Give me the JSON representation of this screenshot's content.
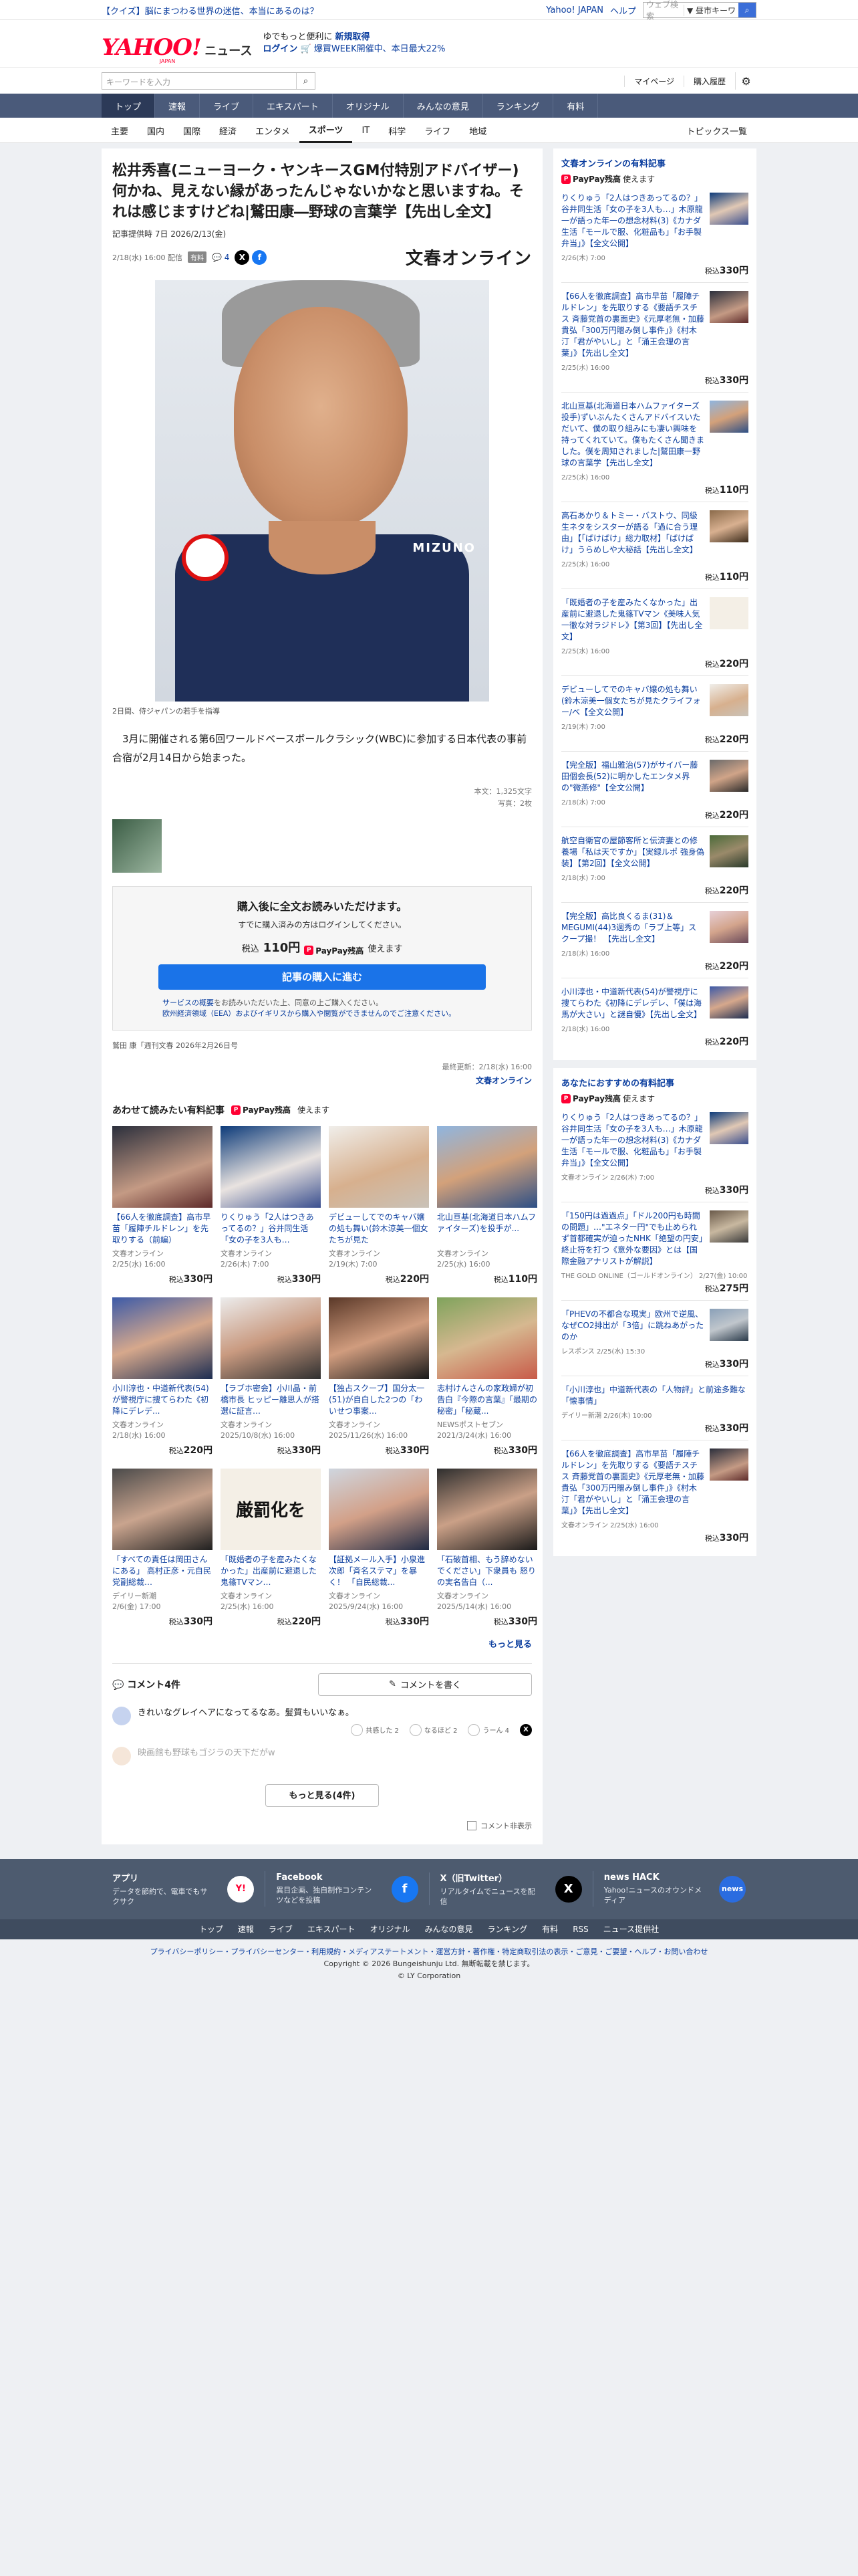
{
  "notice": {
    "text": "【クイズ】脳にまつわる世界の迷信、本当にあるのは？",
    "links": [
      "Yahoo! JAPAN",
      "ヘルプ"
    ],
    "search_placeholder": "ウェブ検索",
    "search_scope": "▼ 昼市キーワ"
  },
  "masthead": {
    "logo_main": "YAHOO!",
    "logo_sub": "JAPAN",
    "logo_news": "ニュース",
    "promo_line1_a": "ゆでもっと便利に",
    "promo_line1_b": "新規取得",
    "promo_line2_a": "ログイン",
    "promo_line2_b": "🛒 爆買WEEK開催中、本日最大22%"
  },
  "searchbar": {
    "placeholder": "キーワードを入力",
    "links": [
      "マイページ",
      "購入履歴"
    ]
  },
  "catnav": [
    "トップ",
    "速報",
    "ライブ",
    "エキスパート",
    "オリジナル",
    "みんなの意見",
    "ランキング",
    "有料"
  ],
  "catnav_active": 0,
  "subnav": [
    "主要",
    "国内",
    "国際",
    "経済",
    "エンタメ",
    "スポーツ",
    "IT",
    "科学",
    "ライフ",
    "地域"
  ],
  "subnav_right": "トピックス一覧",
  "article": {
    "title": "松井秀喜(ニューヨーク・ヤンキースGM付特別アドバイザー)何かね、見えない縁があったんじゃないかなと思いますね。それは感じますけどね|鷲田康―野球の言葉学【先出し全文】",
    "byline": "記事提供時 7日 2026/2/13(金)",
    "date": "2/18(水) 16:00 配信",
    "badge": "有料",
    "comment_count": "4",
    "brand": "文春オンライン",
    "photo_caption": "2日間、侍ジャパンの若手を指導",
    "photo_text": "MIZUNO",
    "lead": "3月に開催される第6回ワールドベースボールクラシック(WBC)に参加する日本代表の事前合宿が2月14日から始まった。",
    "char_count": "本文：1,325文字",
    "photo_count": "写真：2枚"
  },
  "paybox": {
    "title": "購入後に全文お読みいただけます。",
    "sub": "すでに購入済みの方はログインしてください。",
    "price_prefix": "税込",
    "price": "110円",
    "paypay": "PayPay残高",
    "paypay_suffix": "使えます",
    "buy": "記事の購入に進む",
    "note1": "サービスの概要",
    "note1b": "をお読みいただいた上、同意の上ご購入ください。",
    "note2": "欧州経済領域（EEA）およびイギリスから購入や閲覧ができませんのでご注意ください。"
  },
  "source": "鷲田 康「週刊文春 2026年2月26日号",
  "updated": "最終更新：2/18(水) 16:00",
  "updated_by": "文春オンライン",
  "related": {
    "heading": "あわせて読みたい有料記事",
    "paypay": "PayPay残高",
    "paypay_suffix": "使えます",
    "items": [
      {
        "title": "【66人を徹底調査】高市早苗「履陣チルドレン」を先取りする（前編）",
        "src": "文春オンライン",
        "date": "2/25(水) 16:00",
        "price": "330円"
      },
      {
        "title": "りくりゅう「2人はつきあってるの？」谷井同生活「女の子を3人も…",
        "src": "文春オンライン",
        "date": "2/26(木) 7:00",
        "price": "330円"
      },
      {
        "title": "デビューしてでのキャバ嬢の処も舞い(鈴木涼美一個女たちが見た",
        "src": "文春オンライン",
        "date": "2/19(木) 7:00",
        "price": "220円"
      },
      {
        "title": "北山亘基(北海道日本ハムファイターズ)を投手が...",
        "src": "文春オンライン",
        "date": "2/25(水) 16:00",
        "price": "110円"
      },
      {
        "title": "小川淳也・中道新代表(54)が警視庁に捜てらわた《初降にデレデ...",
        "src": "文春オンライン",
        "date": "2/18(水) 16:00",
        "price": "220円"
      },
      {
        "title": "【ラブホ密会】小川晶・前橋市長 ヒッピー離思人が搭選に証言…",
        "src": "文春オンライン",
        "date": "2025/10/8(水) 16:00",
        "price": "330円"
      },
      {
        "title": "【独占スクープ】国分太一(51)が自白した2つの「わいせつ事案…",
        "src": "文春オンライン",
        "date": "2025/11/26(水) 16:00",
        "price": "330円"
      },
      {
        "title": "志村けんさんの家政婦が初告白『今際の言葉』「最期の秘密」「秘蔵...",
        "src": "NEWSポストセブン",
        "date": "2021/3/24(水) 16:00",
        "price": "330円"
      },
      {
        "title": "「すべての責任は岡田さんにある」 高村正彦・元自民党副総裁…",
        "src": "デイリー新潮",
        "date": "2/6(金) 17:00",
        "price": "330円"
      },
      {
        "title": "「既婚者の子を産みたくなかった」出産前に避退した鬼篠TVマン…",
        "src": "文春オンライン",
        "date": "2/25(水) 16:00",
        "price": "220円"
      },
      {
        "title": "【証拠メール入手】小泉進次郎「斉名ステマ」を暴く！ 「自民総裁...",
        "src": "文春オンライン",
        "date": "2025/9/24(水) 16:00",
        "price": "330円"
      },
      {
        "title": "「石破首相、もう辞めないでください」下衆員も 怒りの実名告白（...",
        "src": "文春オンライン",
        "date": "2025/5/14(水) 16:00",
        "price": "330円"
      }
    ],
    "more": "もっと見る"
  },
  "comments": {
    "heading": "コメント4件",
    "write": "コメントを書く",
    "items": [
      {
        "text": "きれいなグレイヘアになってるなあ。髪質もいいなぁ。",
        "r1": "共感した 2",
        "r2": "なるほど 2",
        "r3": "うーん 4"
      },
      {
        "text": "映画館も野球もゴジラの天下だがw"
      }
    ],
    "more": "もっと見る(4件)",
    "hide": "コメント非表示"
  },
  "sidebar": {
    "box1": {
      "heading": "文春オンラインの有料記事",
      "paypay": "PayPay残高",
      "paypay_suffix": "使えます",
      "items": [
        {
          "title": "りくりゅう「2人はつきあってるの？」谷井同生活「女の子を3人も…」木原龍一が語った年一の想念材料(3)《カナダ生活「モールで服、化粧品も」「お手製弁当」》【全文公開】",
          "date": "2/26(木) 7:00",
          "price": "330円"
        },
        {
          "title": "【66人を徹底調査】高市早苗「履陣チルドレン」を先取りする《要語チスチス 斉藤党首の裏面史》《元厚老無・加藤貴弘「300万円贈み倒し事件」》《村木汀「君がやいし」と「涌王会理の言葉」》【先出し全文】",
          "date": "2/25(水) 16:00",
          "price": "330円"
        },
        {
          "title": "北山亘基(北海道日本ハムファイターズ 投手)ずいぶんたくさんアドバイスいただいて、僕の取り組みにも凄い興味を持ってくれていて。僕もたくさん聞きました。僕を周知されました|鷲田康一野球の言葉学【先出し全文】",
          "date": "2/25(水) 16:00",
          "price": "110円"
        },
        {
          "title": "高石あかり＆トミー・バストウ、同級生ネタをシスターが語る「過に合う理由」【「ばけばけ」総力取材】「ばけばけ」うらめしや大秘話【先出し全文】",
          "date": "2/25(水) 16:00",
          "price": "110円"
        },
        {
          "title": "「既婚者の子を産みたくなかった」出産前に避退した鬼篠TVマン《美味人気一徹な対ラジドレ》【第3回】【先出し全文】",
          "date": "2/25(水) 16:00",
          "price": "220円"
        },
        {
          "title": "デビューしてでのキャバ嬢の処も舞い(鈴木涼美一個女たちが見たクライフォー/ベ【全文公開】",
          "date": "2/19(木) 7:00",
          "price": "220円"
        },
        {
          "title": "【完全版】福山雅治(57)がサイバー藤田個会長(52)に明かしたエンタメ界の\"微燕修\"【全文公開】",
          "date": "2/18(水) 7:00",
          "price": "220円"
        },
        {
          "title": "航空自衛官の屋節客所と伝済妻との修養場「私は天ですか」【実録ルポ 強身偽装】【第2回】【全文公開】",
          "date": "2/18(水) 7:00",
          "price": "220円"
        },
        {
          "title": "【完全版】高比良くるま(31)＆MEGUMI(44)3週秀の「ラブ上等」スクープ撮！ 【先出し全文】",
          "date": "2/18(水) 16:00",
          "price": "220円"
        },
        {
          "title": "小川淳也・中道新代表(54)が警視庁に捜てらわた《初降にデレデレ、「僕は海馬が大さい」と謎自慢》【先出し全文】",
          "date": "2/18(水) 16:00",
          "price": "220円"
        }
      ]
    },
    "box2": {
      "heading": "あなたにおすすめの有料記事",
      "paypay": "PayPay残高",
      "paypay_suffix": "使えます",
      "items": [
        {
          "title": "りくりゅう「2人はつきあってるの？」谷井同生活「女の子を3人も…」木原龍一が語った年一の想念材料(3)《カナダ生活「モールで服、化粧品も」「お手製弁当」》【全文公開】",
          "date": "文春オンライン 2/26(木) 7:00",
          "price": "330円"
        },
        {
          "title": "「150円は過過点」「ドル200円も時間の問題」…\"エネター円\"でも止められず首都確実が迫ったNHK「絶望の円安」終止符を打つ《意外な要因》とは【国際金融アナリストが解説】",
          "date": "THE GOLD ONLINE（ゴールドオンライン） 2/27(金) 10:00",
          "price": "275円"
        },
        {
          "title": "「PHEVの不都合な現実」欧州で逆風、なぜCO2排出が「3倍」に跳ねあがったのか",
          "date": "レスポンス 2/25(水) 15:30",
          "price": "330円"
        },
        {
          "title": "「小川淳也」中道新代表の「人物評」と前途多難な「懐事情」",
          "date": "デイリー新潮 2/26(木) 10:00",
          "price": "330円"
        },
        {
          "title": "【66人を徹底調査】高市早苗「履陣チルドレン」を先取りする《要語チスチス 斉藤党首の裏面史》《元厚老無・加藤貴弘「300万円贈み倒し事件」》《村木汀「君がやいし」と「涌王会理の言葉」》【先出し全文】",
          "date": "文春オンライン 2/25(水) 16:00",
          "price": "330円"
        }
      ]
    }
  },
  "footer": {
    "boxes": [
      {
        "title": "アプリ",
        "desc": "データを節約で、電車でもサクサク",
        "icon": "Y!"
      },
      {
        "title": "Facebook",
        "desc": "異目企画、独自制作コンテンツなどを投稿",
        "icon": "f"
      },
      {
        "title": "X（旧Twitter）",
        "desc": "リアルタイムでニュースを配信",
        "icon": "X"
      },
      {
        "title": "news HACK",
        "desc": "Yahoo!ニュースのオウンドメディア",
        "icon": "news"
      }
    ],
    "links": [
      "トップ",
      "速報",
      "ライブ",
      "エキスパート",
      "オリジナル",
      "みんなの意見",
      "ランキング",
      "有料",
      "RSS",
      "ニュース提供社"
    ],
    "legal1": "プライバシーポリシー・プライバシーセンター・利用規約・メディアステートメント・運営方針・著作権・特定商取引法の表示・ご意見・ご要望・ヘルプ・お問い合わせ",
    "legal2": "Copyright © 2026 Bungeishunju Ltd. 無断転載を禁じます。",
    "legal3": "© LY Corporation"
  }
}
